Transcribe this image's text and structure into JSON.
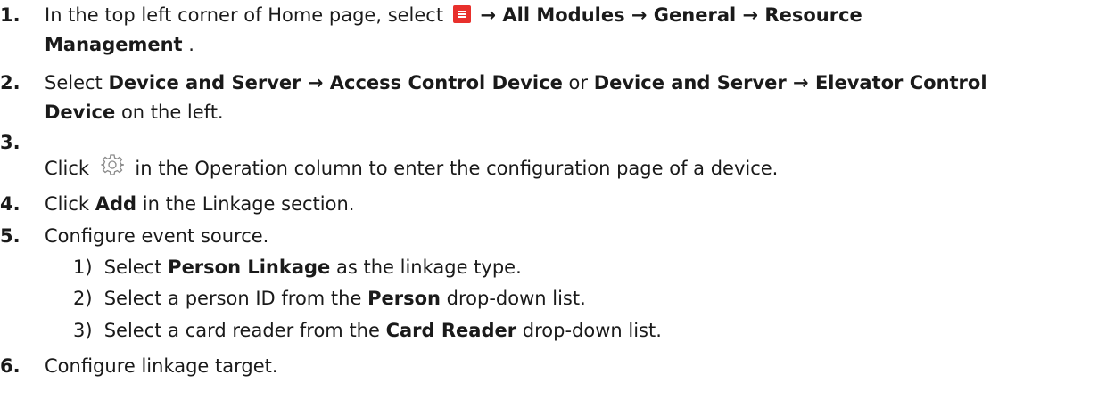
{
  "steps": [
    {
      "num": "1.",
      "line1_pre": "In the top left corner of Home page, select",
      "line1_path": "→ All Modules → General → Resource",
      "line2_bold": "Management",
      "line2_post": "."
    },
    {
      "num": "2.",
      "pre": "Select",
      "bold1": "Device and Server → Access Control Device",
      "mid": "or",
      "bold2": "Device and Server → Elevator Control",
      "line2_bold": "Device",
      "line2_post": "on the left."
    },
    {
      "num": "3.",
      "pre": "Click",
      "post": "in the Operation column to enter the configuration page of a device."
    },
    {
      "num": "4.",
      "pre": "Click",
      "bold": "Add",
      "post": "in the Linkage section."
    },
    {
      "num": "5.",
      "text": "Configure event source.",
      "substeps": [
        {
          "num": "1)",
          "pre": "Select",
          "bold": "Person Linkage",
          "post": "as the linkage type."
        },
        {
          "num": "2)",
          "pre": "Select a person ID from the",
          "bold": "Person",
          "post": "drop-down list."
        },
        {
          "num": "3)",
          "pre": "Select a card reader from the",
          "bold": "Card Reader",
          "post": "drop-down list."
        }
      ]
    },
    {
      "num": "6.",
      "text": "Configure linkage target."
    }
  ],
  "icons": {
    "menu": "menu-icon",
    "gear": "gear-icon"
  },
  "colors": {
    "menu_icon_bg": "#e8302c",
    "text": "#1a1a1a"
  }
}
